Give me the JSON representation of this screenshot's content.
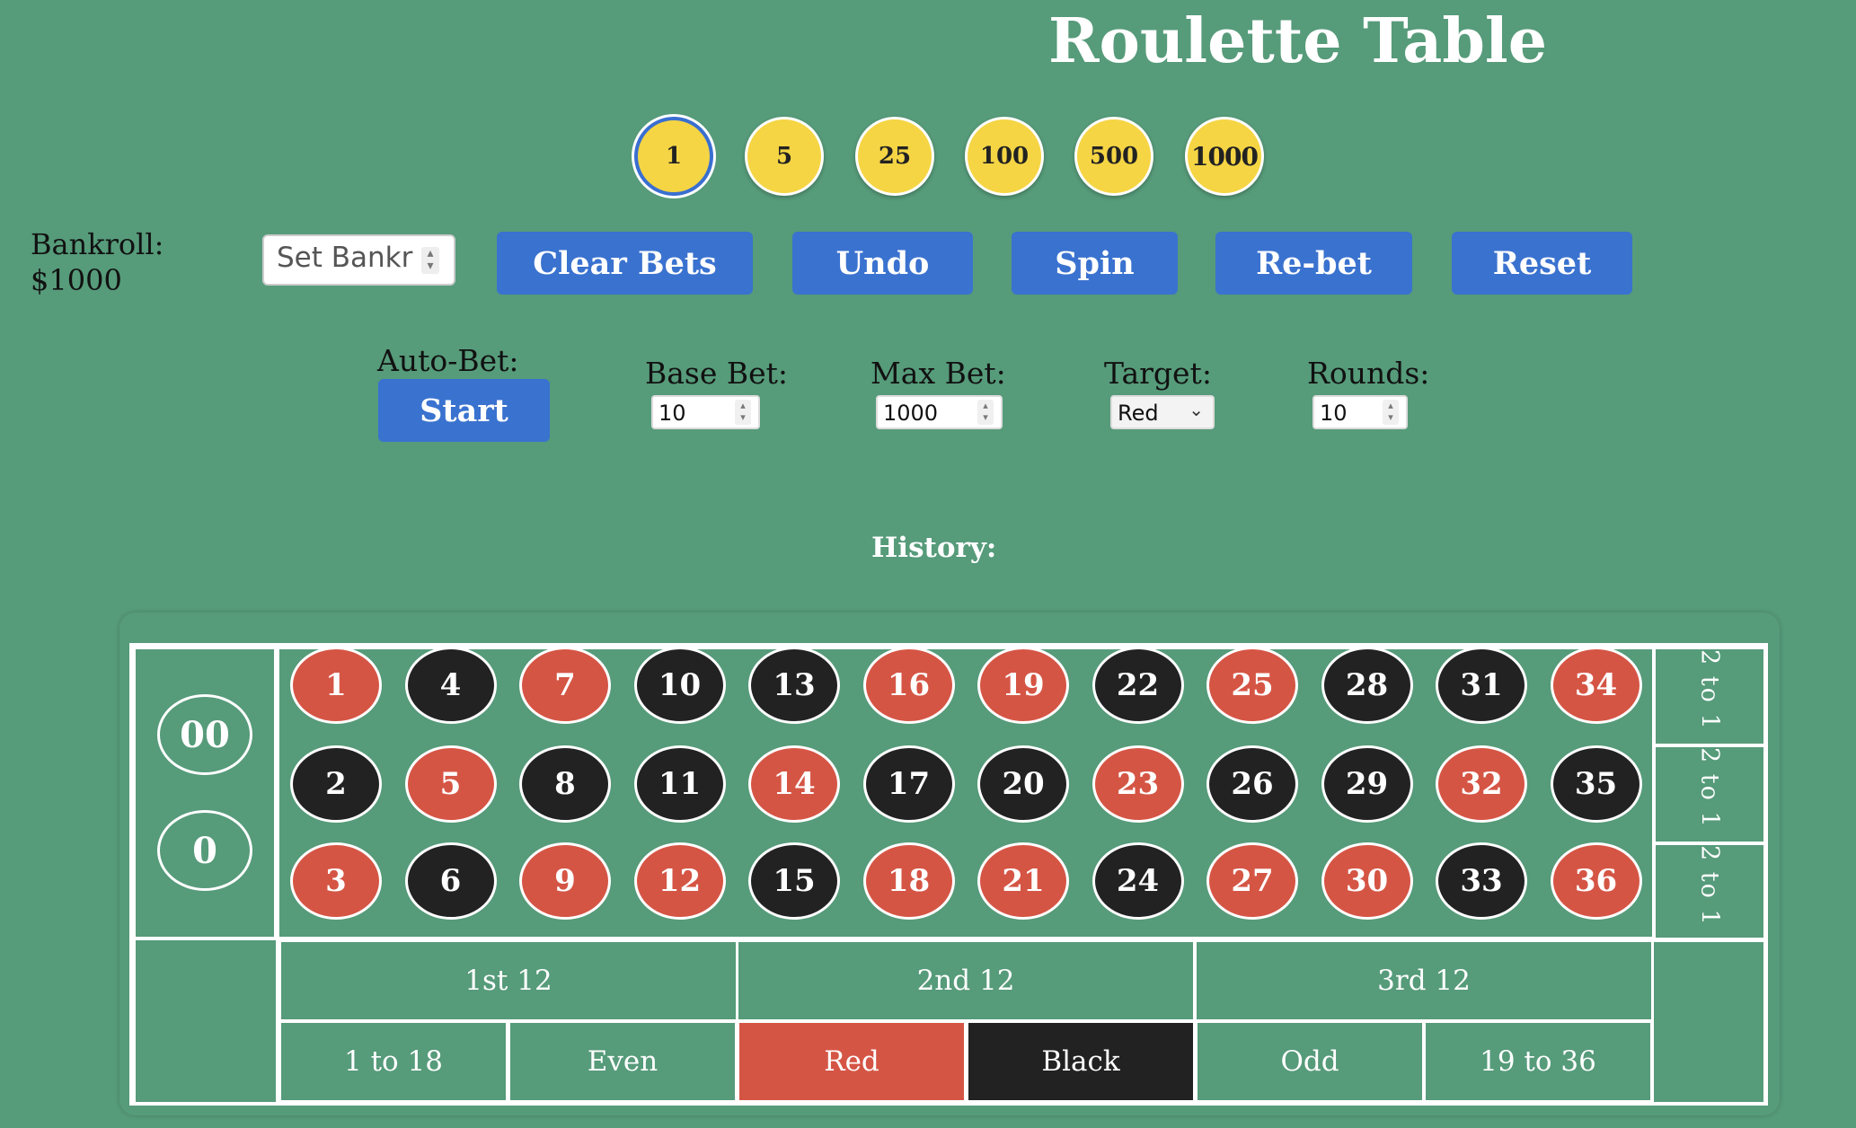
{
  "title": "Roulette Table",
  "chips": [
    {
      "value": "1",
      "selected": true
    },
    {
      "value": "5",
      "selected": false
    },
    {
      "value": "25",
      "selected": false
    },
    {
      "value": "100",
      "selected": false
    },
    {
      "value": "500",
      "selected": false
    },
    {
      "value": "1000",
      "selected": false
    }
  ],
  "bankroll": {
    "label": "Bankroll:",
    "value": "$1000",
    "input_placeholder": "Set Bankr"
  },
  "buttons": {
    "clear_bets": "Clear Bets",
    "undo": "Undo",
    "spin": "Spin",
    "rebet": "Re-bet",
    "reset": "Reset"
  },
  "autobet": {
    "label": "Auto-Bet:",
    "start": "Start",
    "base_bet_label": "Base Bet:",
    "base_bet_value": "10",
    "max_bet_label": "Max Bet:",
    "max_bet_value": "1000",
    "target_label": "Target:",
    "target_value": "Red",
    "rounds_label": "Rounds:",
    "rounds_value": "10"
  },
  "history_label": "History:",
  "table": {
    "zeros": [
      "00",
      "0"
    ],
    "numbers": [
      {
        "n": "1",
        "color": "red"
      },
      {
        "n": "4",
        "color": "black"
      },
      {
        "n": "7",
        "color": "red"
      },
      {
        "n": "10",
        "color": "black"
      },
      {
        "n": "13",
        "color": "black"
      },
      {
        "n": "16",
        "color": "red"
      },
      {
        "n": "19",
        "color": "red"
      },
      {
        "n": "22",
        "color": "black"
      },
      {
        "n": "25",
        "color": "red"
      },
      {
        "n": "28",
        "color": "black"
      },
      {
        "n": "31",
        "color": "black"
      },
      {
        "n": "34",
        "color": "red"
      },
      {
        "n": "2",
        "color": "black"
      },
      {
        "n": "5",
        "color": "red"
      },
      {
        "n": "8",
        "color": "black"
      },
      {
        "n": "11",
        "color": "black"
      },
      {
        "n": "14",
        "color": "red"
      },
      {
        "n": "17",
        "color": "black"
      },
      {
        "n": "20",
        "color": "black"
      },
      {
        "n": "23",
        "color": "red"
      },
      {
        "n": "26",
        "color": "black"
      },
      {
        "n": "29",
        "color": "black"
      },
      {
        "n": "32",
        "color": "red"
      },
      {
        "n": "35",
        "color": "black"
      },
      {
        "n": "3",
        "color": "red"
      },
      {
        "n": "6",
        "color": "black"
      },
      {
        "n": "9",
        "color": "red"
      },
      {
        "n": "12",
        "color": "red"
      },
      {
        "n": "15",
        "color": "black"
      },
      {
        "n": "18",
        "color": "red"
      },
      {
        "n": "21",
        "color": "red"
      },
      {
        "n": "24",
        "color": "black"
      },
      {
        "n": "27",
        "color": "red"
      },
      {
        "n": "30",
        "color": "red"
      },
      {
        "n": "33",
        "color": "black"
      },
      {
        "n": "36",
        "color": "red"
      }
    ],
    "columns": [
      "2 to 1",
      "2 to 1",
      "2 to 1"
    ],
    "dozens": [
      "1st 12",
      "2nd 12",
      "3rd 12"
    ],
    "even_money": [
      {
        "label": "1 to 18",
        "style": "plain"
      },
      {
        "label": "Even",
        "style": "plain"
      },
      {
        "label": "Red",
        "style": "red"
      },
      {
        "label": "Black",
        "style": "black"
      },
      {
        "label": "Odd",
        "style": "plain"
      },
      {
        "label": "19 to 36",
        "style": "plain"
      }
    ]
  },
  "colors": {
    "felt": "#569b7a",
    "red": "#d55545",
    "black": "#222222",
    "button": "#3a72cf",
    "chip": "#f5d544"
  }
}
